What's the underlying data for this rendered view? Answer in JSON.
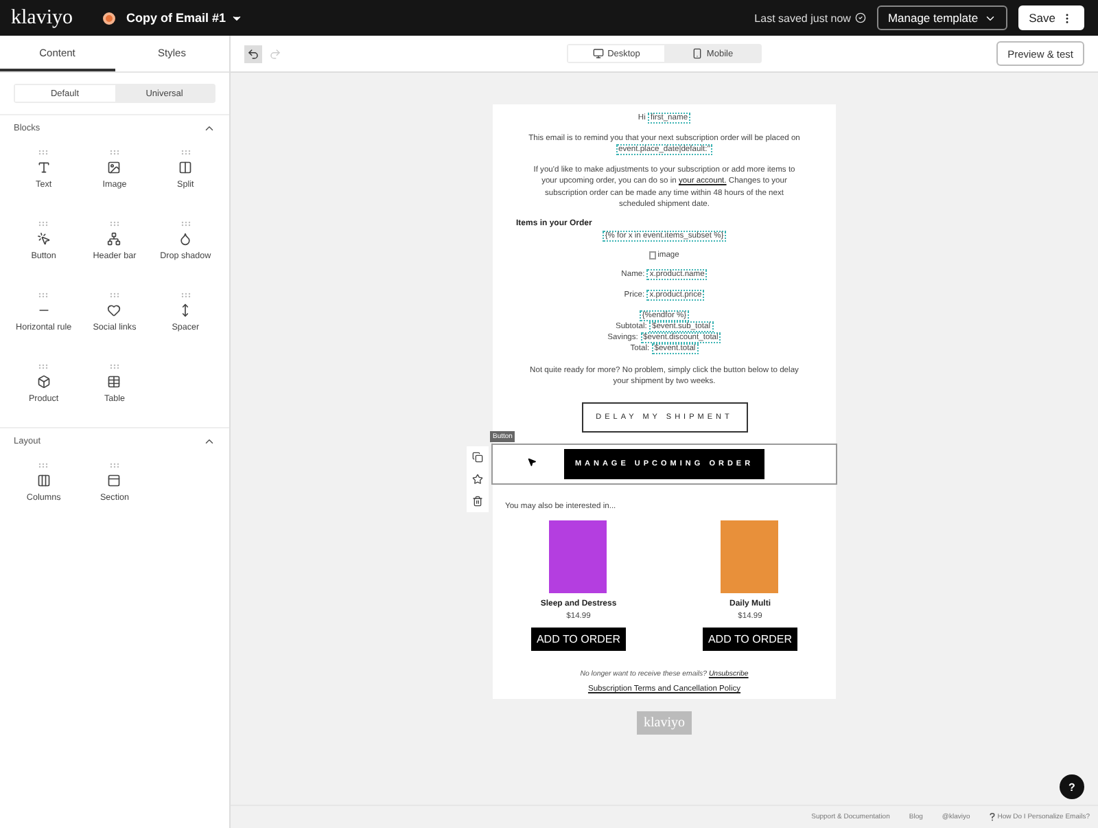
{
  "topbar": {
    "logo": "klaviyo",
    "title": "Copy of Email #1",
    "save_status": "Last saved just now",
    "manage_button": "Manage template",
    "save_button": "Save"
  },
  "sidebar": {
    "tabs": [
      {
        "label": "Content",
        "selected": true
      },
      {
        "label": "Styles",
        "selected": false
      }
    ],
    "modes": [
      {
        "label": "Default",
        "selected": true
      },
      {
        "label": "Universal",
        "selected": false
      }
    ],
    "sections": [
      {
        "title": "Blocks",
        "expanded": true,
        "items": [
          {
            "label": "Text",
            "kind": "text"
          },
          {
            "label": "Image",
            "kind": "image"
          },
          {
            "label": "Split",
            "kind": "split"
          },
          {
            "label": "Button",
            "kind": "button"
          },
          {
            "label": "Header bar",
            "kind": "header"
          },
          {
            "label": "Drop shadow",
            "kind": "shadow"
          },
          {
            "label": "Horizontal rule",
            "kind": "rule"
          },
          {
            "label": "Social links",
            "kind": "social"
          },
          {
            "label": "Spacer",
            "kind": "spacer"
          },
          {
            "label": "Product",
            "kind": "product"
          },
          {
            "label": "Table",
            "kind": "table"
          }
        ]
      },
      {
        "title": "Layout",
        "expanded": true,
        "items": [
          {
            "label": "Columns",
            "kind": "columns"
          },
          {
            "label": "Section",
            "kind": "section"
          }
        ]
      }
    ]
  },
  "toolbar": {
    "views": [
      {
        "label": "Desktop",
        "kind": "desktop",
        "selected": true
      },
      {
        "label": "Mobile",
        "kind": "mobile",
        "selected": false
      }
    ],
    "preview_button": "Preview & test"
  },
  "email": {
    "blocks": [
      {
        "kind": "paragraph",
        "parts": [
          {
            "text": "Hi ",
            "kind": "plain"
          },
          {
            "text": "first_name",
            "kind": "tag"
          }
        ]
      },
      {
        "kind": "paragraph",
        "parts": [
          {
            "text": "This email is to remind you that your next subscription order will be placed on ",
            "kind": "plain"
          },
          {
            "text": "event.place_date|default:''",
            "kind": "tag"
          }
        ]
      },
      {
        "kind": "paragraph",
        "parts": [
          {
            "text": "If you'd like to make adjustments to your subscription or add more items to your upcoming order, you can do so in ",
            "kind": "plain"
          },
          {
            "text": "your account.",
            "kind": "link"
          },
          {
            "text": " Changes to your subscription order can be made any time within 48 hours of the next scheduled shipment date.",
            "kind": "plain"
          }
        ]
      },
      {
        "kind": "heading",
        "text": "Items in your Order"
      },
      {
        "kind": "paragraph",
        "parts": [
          {
            "text": "{% for x in event.items_subset %}",
            "kind": "tag"
          }
        ]
      },
      {
        "kind": "image",
        "text": "image"
      },
      {
        "kind": "paragraph",
        "parts": [
          {
            "text": "Name: ",
            "kind": "plain"
          },
          {
            "text": "x.product.name",
            "kind": "tag"
          }
        ]
      },
      {
        "kind": "paragraph",
        "parts": [
          {
            "text": "Price: ",
            "kind": "plain"
          },
          {
            "text": "x.product.price",
            "kind": "tag"
          }
        ]
      },
      {
        "kind": "lines",
        "lines": [
          [
            {
              "text": "{%endfor %}",
              "kind": "tag"
            }
          ],
          [
            {
              "text": "Subtotal: ",
              "kind": "plain"
            },
            {
              "text": "$event.sub_total",
              "kind": "tag"
            }
          ],
          [
            {
              "text": "Savings: ",
              "kind": "plain"
            },
            {
              "text": "$event.discount_total",
              "kind": "tag"
            }
          ],
          [
            {
              "text": "Total: ",
              "kind": "plain"
            },
            {
              "text": "$event.total",
              "kind": "tag"
            }
          ]
        ]
      },
      {
        "kind": "paragraph",
        "parts": [
          {
            "text": "Not quite ready for more? No problem, simply click the button below to delay your shipment by two weeks.",
            "kind": "plain"
          }
        ]
      },
      {
        "kind": "outline-button",
        "text": "DELAY MY SHIPMENT",
        "selected": false
      },
      {
        "kind": "solid-button",
        "text": "MANAGE UPCOMING ORDER",
        "selected": true,
        "tag": "Button"
      },
      {
        "kind": "intro",
        "text": "You may also be interested in..."
      },
      {
        "kind": "products",
        "items": [
          {
            "name": "Sleep and Destress",
            "price": "$14.99",
            "button": "ADD TO ORDER",
            "color": "#b43ee0"
          },
          {
            "name": "Daily Multi",
            "price": "$14.99",
            "button": "ADD TO ORDER",
            "color": "#e8903a"
          }
        ]
      },
      {
        "kind": "footnote",
        "parts": [
          {
            "text": "No longer want to receive these emails? ",
            "kind": "plain"
          },
          {
            "text": "Unsubscribe",
            "kind": "link"
          }
        ]
      },
      {
        "kind": "policy",
        "parts": [
          {
            "text": "Subscription Terms and Cancellation Policy",
            "kind": "link"
          }
        ]
      }
    ],
    "footer_logo": "klaviyo"
  },
  "footer_links": [
    {
      "label": "Support & Documentation",
      "kind": "plain"
    },
    {
      "label": "Blog",
      "kind": "plain"
    },
    {
      "label": "@klaviyo",
      "kind": "plain"
    },
    {
      "label": "How Do I Personalize Emails?",
      "kind": "help"
    }
  ],
  "help_button": "?"
}
